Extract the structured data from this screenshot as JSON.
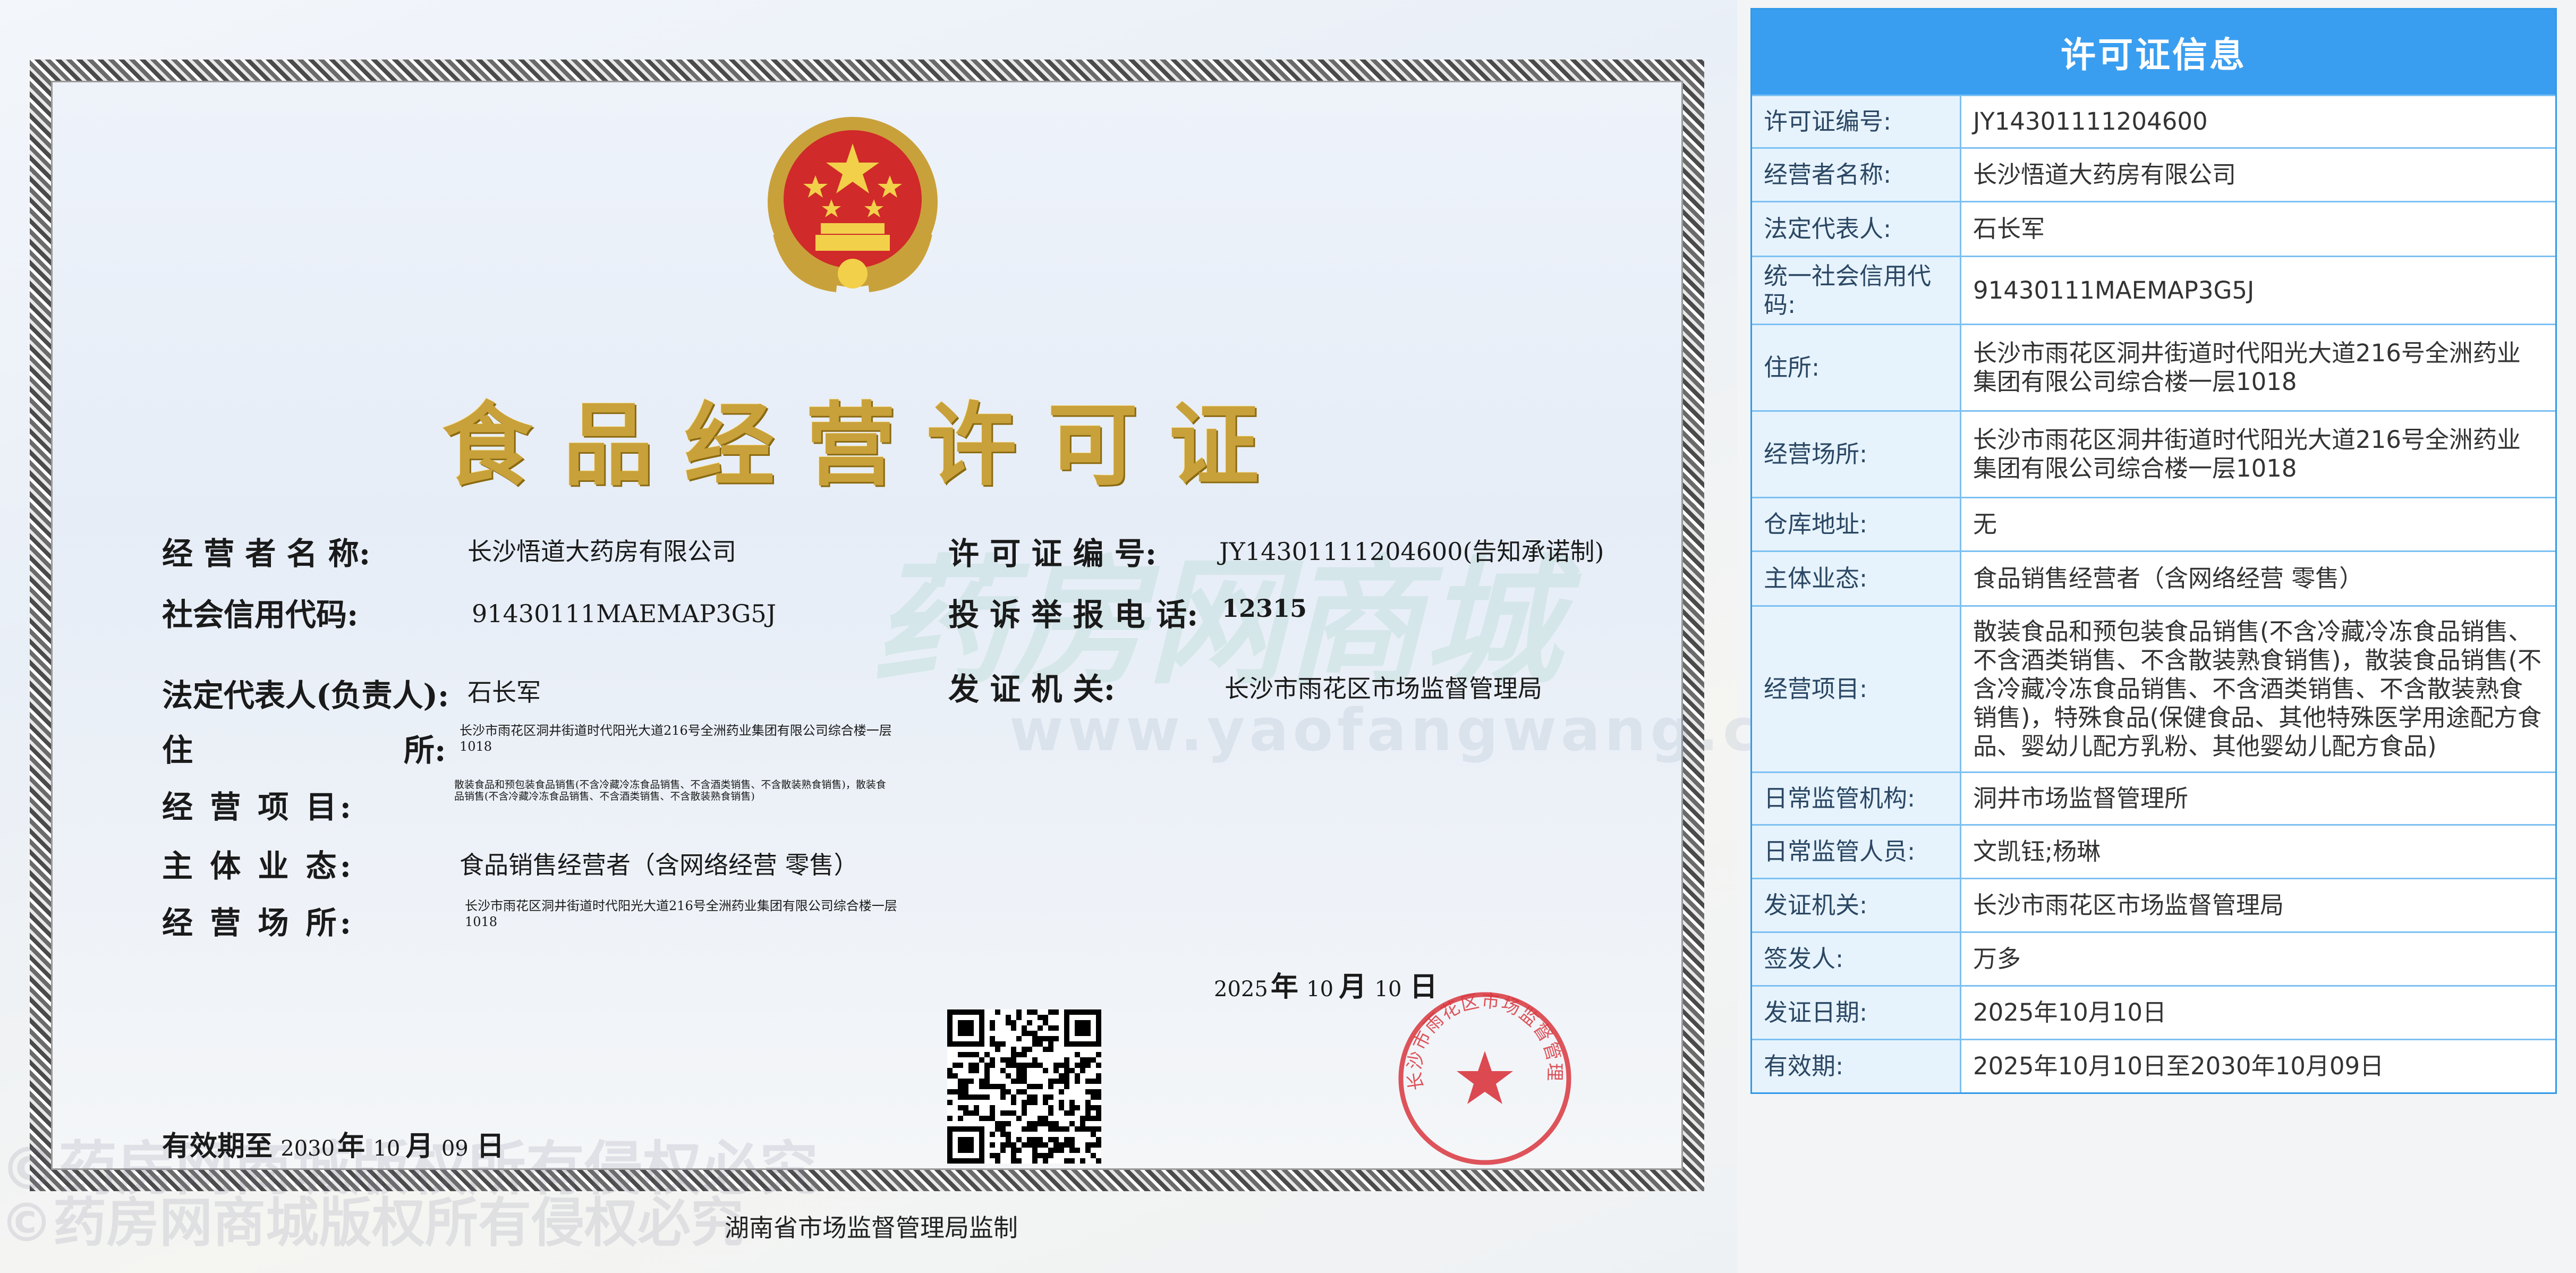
{
  "certificate": {
    "title": "食品经营许可证",
    "fields": {
      "operator_label": "经 营 者 名 称:",
      "operator_value": "长沙悟道大药房有限公司",
      "credit_label": "社会信用代码:",
      "credit_value": "91430111MAEMAP3G5J",
      "legal_label": "法定代表人(负责人):",
      "legal_value": "石长军",
      "address_label_a": "住",
      "address_label_b": "所:",
      "address_value": "长沙市雨花区洞井街道时代阳光大道216号全洲药业集团有限公司综合楼一层1018",
      "items_label": "经 营 项 目:",
      "items_value": "散装食品和预包装食品销售(不含冷藏冷冻食品销售、不含酒类销售、不含散装熟食销售)，散装食品销售(不含冷藏冷冻食品销售、不含酒类销售、不含散装熟食销售)",
      "form_label": "主 体 业 态:",
      "form_value": "食品销售经营者（含网络经营 零售）",
      "premises_label": "经 营 场 所:",
      "premises_value": "长沙市雨花区洞井街道时代阳光大道216号全洲药业集团有限公司综合楼一层1018",
      "license_no_label": "许 可 证 编 号:",
      "license_no_value": "JY14301111204600(告知承诺制)",
      "complaint_label": "投 诉 举 报 电 话:",
      "complaint_value": "12315",
      "authority_label": "发 证 机 关:",
      "authority_value": "长沙市雨花区市场监督管理局"
    },
    "issue_date": {
      "year": "2025",
      "year_unit": "年",
      "month": "10",
      "month_unit": "月",
      "day": "10",
      "day_unit": "日"
    },
    "valid_until": {
      "label": "有效期至",
      "year": "2030",
      "year_unit": "年",
      "month": "10",
      "month_unit": "月",
      "day": "09",
      "day_unit": "日"
    },
    "seal_text": "长沙市雨花区市场监督管理局",
    "footer": "湖南省市场监督管理局监制",
    "watermark": {
      "brand": "药房网商城",
      "url": "www.yaofangwang.com",
      "copyright": "©药房网商城版权所有侵权必究"
    }
  },
  "panel": {
    "title": "许可证信息",
    "rows": [
      {
        "key": "许可证编号:",
        "value": "JY14301111204600"
      },
      {
        "key": "经营者名称:",
        "value": "长沙悟道大药房有限公司"
      },
      {
        "key": "法定代表人:",
        "value": "石长军"
      },
      {
        "key": "统一社会信用代码:",
        "value": "91430111MAEMAP3G5J"
      },
      {
        "key": "住所:",
        "value": "长沙市雨花区洞井街道时代阳光大道216号全洲药业集团有限公司综合楼一层1018"
      },
      {
        "key": "经营场所:",
        "value": "长沙市雨花区洞井街道时代阳光大道216号全洲药业集团有限公司综合楼一层1018"
      },
      {
        "key": "仓库地址:",
        "value": "无"
      },
      {
        "key": "主体业态:",
        "value": "食品销售经营者（含网络经营 零售）"
      },
      {
        "key": "经营项目:",
        "value": "散装食品和预包装食品销售(不含冷藏冷冻食品销售、不含酒类销售、不含散装熟食销售)，散装食品销售(不含冷藏冷冻食品销售、不含酒类销售、不含散装熟食销售)，特殊食品(保健食品、其他特殊医学用途配方食品、婴幼儿配方乳粉、其他婴幼儿配方食品)"
      },
      {
        "key": "日常监管机构:",
        "value": "洞井市场监督管理所"
      },
      {
        "key": "日常监管人员:",
        "value": "文凯钰;杨琳"
      },
      {
        "key": "发证机关:",
        "value": "长沙市雨花区市场监督管理局"
      },
      {
        "key": "签发人:",
        "value": "万多"
      },
      {
        "key": "发证日期:",
        "value": "2025年10月10日"
      },
      {
        "key": "有效期:",
        "value": "2025年10月10日至2030年10月09日"
      }
    ]
  },
  "colors": {
    "panel_header": "#3a9ef0",
    "panel_key_bg": "#e6f3fd",
    "title_gold": "#c9a13a",
    "seal_red": "#d9363e"
  }
}
